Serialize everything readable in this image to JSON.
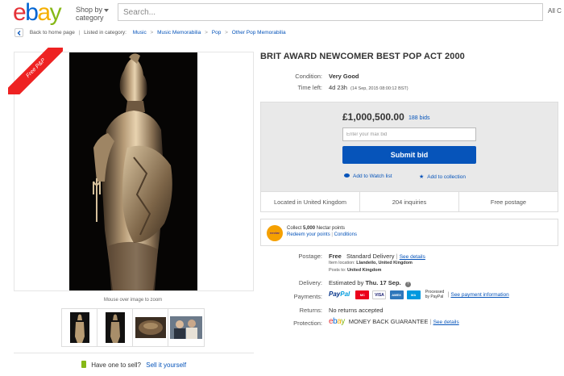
{
  "header": {
    "logo": {
      "e": "e",
      "b": "b",
      "a": "a",
      "y": "y"
    },
    "shop_by_line1": "Shop by",
    "shop_by_line2": "category",
    "search_placeholder": "Search...",
    "category_select": "All C"
  },
  "breadcrumb": {
    "back": "Back to home page",
    "listed_in": "Listed in category:",
    "items": [
      "Music",
      "Music Memorabilia",
      "Pop",
      "Other Pop Memorabilia"
    ]
  },
  "gallery": {
    "ribbon": "Free P&P",
    "zoom_hint": "Mouse over image to zoom"
  },
  "sell": {
    "text": "Have one to sell?",
    "link": "Sell it yourself"
  },
  "item": {
    "title": "BRIT AWARD NEWCOMER BEST POP ACT 2000",
    "condition_label": "Condition:",
    "condition": "Very Good",
    "time_left_label": "Time left:",
    "time_left": "4d 23h",
    "time_left_detail": "(14 Sep, 2015  08:00:12 BST)"
  },
  "bid": {
    "price": "£1,000,500.00",
    "bids": "188 bids",
    "input_placeholder": "Enter your max bid",
    "submit": "Submit bid",
    "watch": "Add to Watch list",
    "collection": "Add to collection"
  },
  "info": {
    "location": "Located in United Kingdom",
    "inquiries": "204 inquiries",
    "postage": "Free postage"
  },
  "nectar": {
    "logo": "nectar",
    "collect_prefix": "Collect ",
    "points": "5,000",
    "collect_suffix": " Nectar points",
    "redeem": "Redeem your points",
    "conditions": "Conditions"
  },
  "details": {
    "postage_label": "Postage:",
    "postage_free": "Free",
    "postage_type": "Standard Delivery",
    "see_details": "See details",
    "item_location": "Item location:",
    "item_location_val": "Llandeilo, United Kingdom",
    "posts_to": "Posts to:",
    "posts_to_val": "United Kingdom",
    "delivery_label": "Delivery:",
    "delivery_prefix": "Estimated by",
    "delivery_date": "Thu. 17 Sep.",
    "payments_label": "Payments:",
    "paypal_1": "Pay",
    "paypal_2": "Pal",
    "processed": "Processed",
    "by_paypal": "by PayPal",
    "see_payment": "See payment information",
    "returns_label": "Returns:",
    "returns": "No returns accepted",
    "protection_label": "Protection:",
    "mbg": "MONEY BACK GUARANTEE",
    "see_details_2": "See details"
  },
  "cards": {
    "mc": "MC",
    "visa": "VISA",
    "amex": "AMEX",
    "maestro": "MA"
  },
  "colors": {
    "ebay_blue": "#0654ba",
    "ribbon_red": "#e22",
    "bidbox_gray": "#e9e9e9"
  }
}
